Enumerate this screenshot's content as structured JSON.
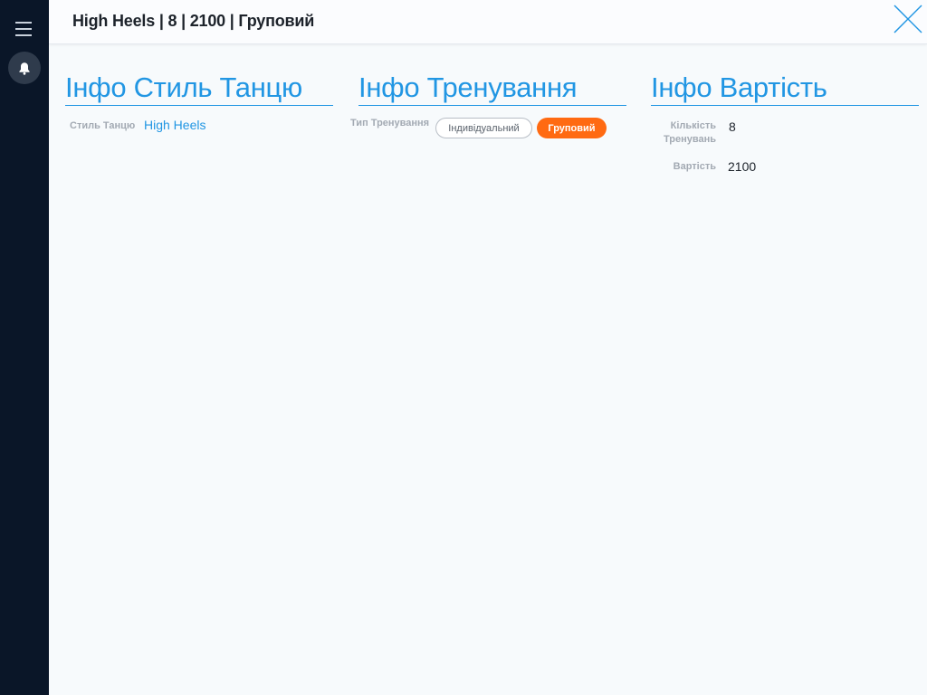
{
  "header": {
    "title": "High Heels | 8 | 2100 | Груповий",
    "close_icon": "close-icon"
  },
  "sidebar": {
    "menu_icon": "hamburger-menu-icon",
    "notifications_icon": "bell-icon"
  },
  "colors": {
    "accent": "#2196e3",
    "active_chip": "#ff6a12",
    "sidebar_bg": "#0a1628"
  },
  "sections": {
    "style": {
      "title": "Інфо Стиль Танцю",
      "label": "Стиль Танцю",
      "value": "High Heels"
    },
    "training": {
      "title": "Інфо Тренування",
      "label": "Тип Тренування",
      "options": [
        "Індивідуальний",
        "Груповий"
      ],
      "selected": "Груповий"
    },
    "price": {
      "title": "Інфо Вартість",
      "count_label_line1": "Кількість",
      "count_label_line2": "Тренувань",
      "count_value": "8",
      "price_label": "Вартість",
      "price_value": "2100"
    }
  }
}
